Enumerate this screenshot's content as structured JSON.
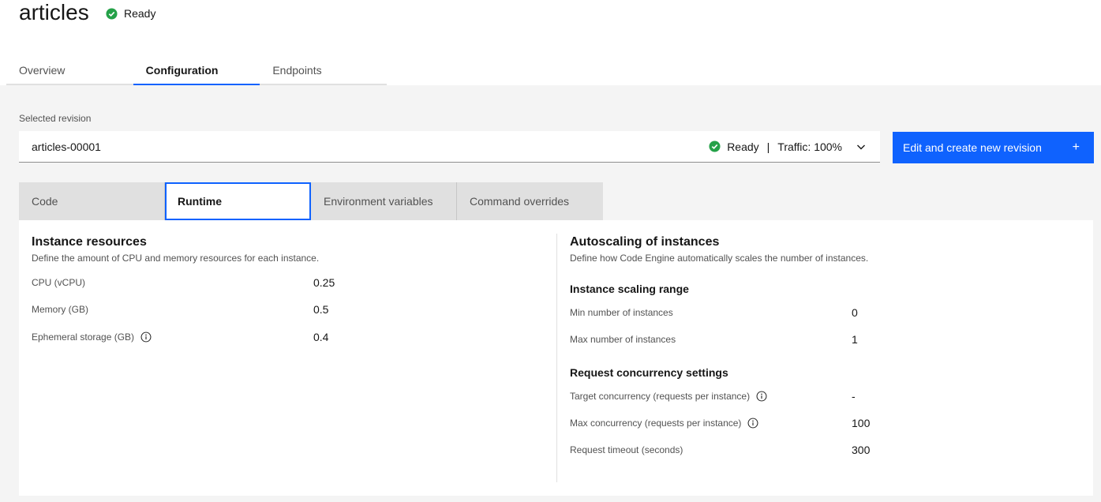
{
  "header": {
    "title": "articles",
    "status": "Ready",
    "status_color": "#24a148"
  },
  "tabs": [
    {
      "label": "Overview",
      "active": false
    },
    {
      "label": "Configuration",
      "active": true
    },
    {
      "label": "Endpoints",
      "active": false
    }
  ],
  "revision": {
    "label": "Selected revision",
    "value": "articles-00001",
    "status": "Ready",
    "separator": "|",
    "traffic": "Traffic: 100%"
  },
  "primary_button": {
    "label": "Edit and create new revision",
    "icon": "+",
    "color": "#0f62fe"
  },
  "subtabs": [
    {
      "label": "Code",
      "active": false
    },
    {
      "label": "Runtime",
      "active": true
    },
    {
      "label": "Environment variables",
      "active": false
    },
    {
      "label": "Command overrides",
      "active": false
    }
  ],
  "instance_resources": {
    "title": "Instance resources",
    "description": "Define the amount of CPU and memory resources for each instance.",
    "rows": [
      {
        "label": "CPU (vCPU)",
        "value": "0.25",
        "info": false
      },
      {
        "label": "Memory (GB)",
        "value": "0.5",
        "info": false
      },
      {
        "label": "Ephemeral storage (GB)",
        "value": "0.4",
        "info": true
      }
    ]
  },
  "autoscaling": {
    "title": "Autoscaling of instances",
    "description": "Define how Code Engine automatically scales the number of instances.",
    "scaling_title": "Instance scaling range",
    "scaling_rows": [
      {
        "label": "Min number of instances",
        "value": "0",
        "info": false
      },
      {
        "label": "Max number of instances",
        "value": "1",
        "info": false
      }
    ],
    "concurrency_title": "Request concurrency settings",
    "concurrency_rows": [
      {
        "label": "Target concurrency (requests per instance)",
        "value": "-",
        "info": true
      },
      {
        "label": "Max concurrency (requests per instance)",
        "value": "100",
        "info": true
      },
      {
        "label": "Request timeout (seconds)",
        "value": "300",
        "info": false
      }
    ]
  }
}
